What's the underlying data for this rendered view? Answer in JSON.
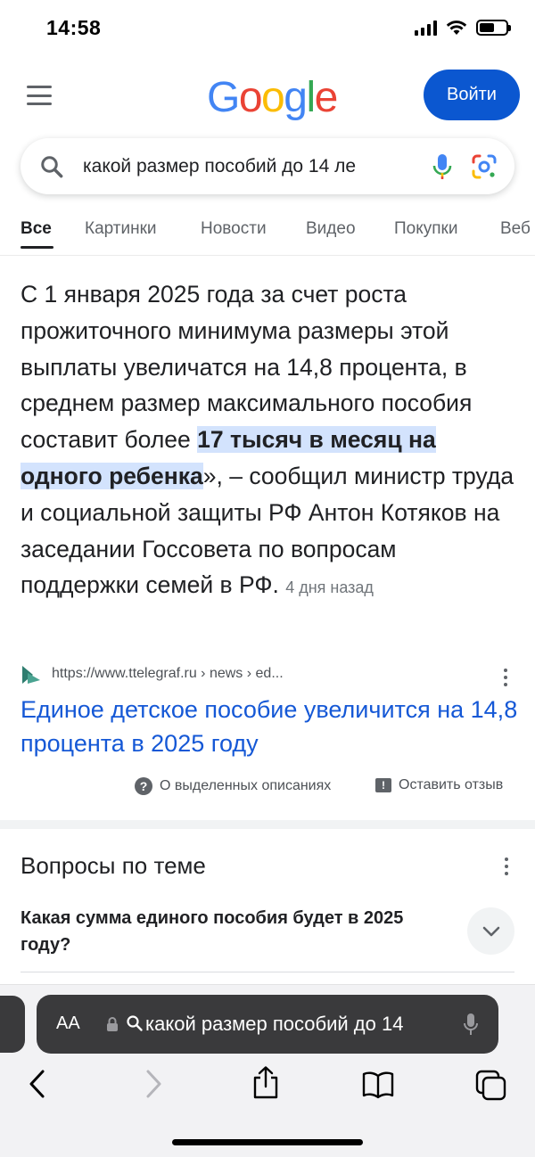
{
  "status": {
    "time": "14:58"
  },
  "header": {
    "logo_letters": [
      "G",
      "o",
      "o",
      "g",
      "l",
      "e"
    ],
    "signin_label": "Войти"
  },
  "search": {
    "query": "какой размер пособий до 14 ле"
  },
  "tabs": [
    {
      "label": "Все",
      "active": true
    },
    {
      "label": "Картинки",
      "active": false
    },
    {
      "label": "Новости",
      "active": false
    },
    {
      "label": "Видео",
      "active": false
    },
    {
      "label": "Покупки",
      "active": false
    },
    {
      "label": "Веб",
      "active": false
    }
  ],
  "featured_snippet": {
    "text_before": "С 1 января 2025 года за счет роста прожиточного минимума размеры этой выплаты увеличатся на 14,8 процента, в среднем размер максимального пособия составит более ",
    "highlight": "17 тысяч в месяц на одного ребенка",
    "text_after": "», – сообщил министр труда и социальной защиты РФ Антон Котяков на заседании Госсовета по вопросам поддержки семей в РФ.",
    "age": "4 дня назад",
    "source_url": "https://www.ttelegraf.ru › news › ed...",
    "result_title": "Единое детское пособие увеличится на 14,8 процента в 2025 году",
    "about_label": "О выделенных описаниях",
    "feedback_label": "Оставить отзыв"
  },
  "related_questions": {
    "title": "Вопросы по теме",
    "items": [
      "Какая сумма единого пособия будет в 2025 году?"
    ]
  },
  "safari": {
    "aa_label": "AA",
    "url_text": "какой размер пособий до 14"
  },
  "colors": {
    "accent": "#0b57d0",
    "link": "#1558d6",
    "highlight_bg": "#d3e3fd"
  }
}
